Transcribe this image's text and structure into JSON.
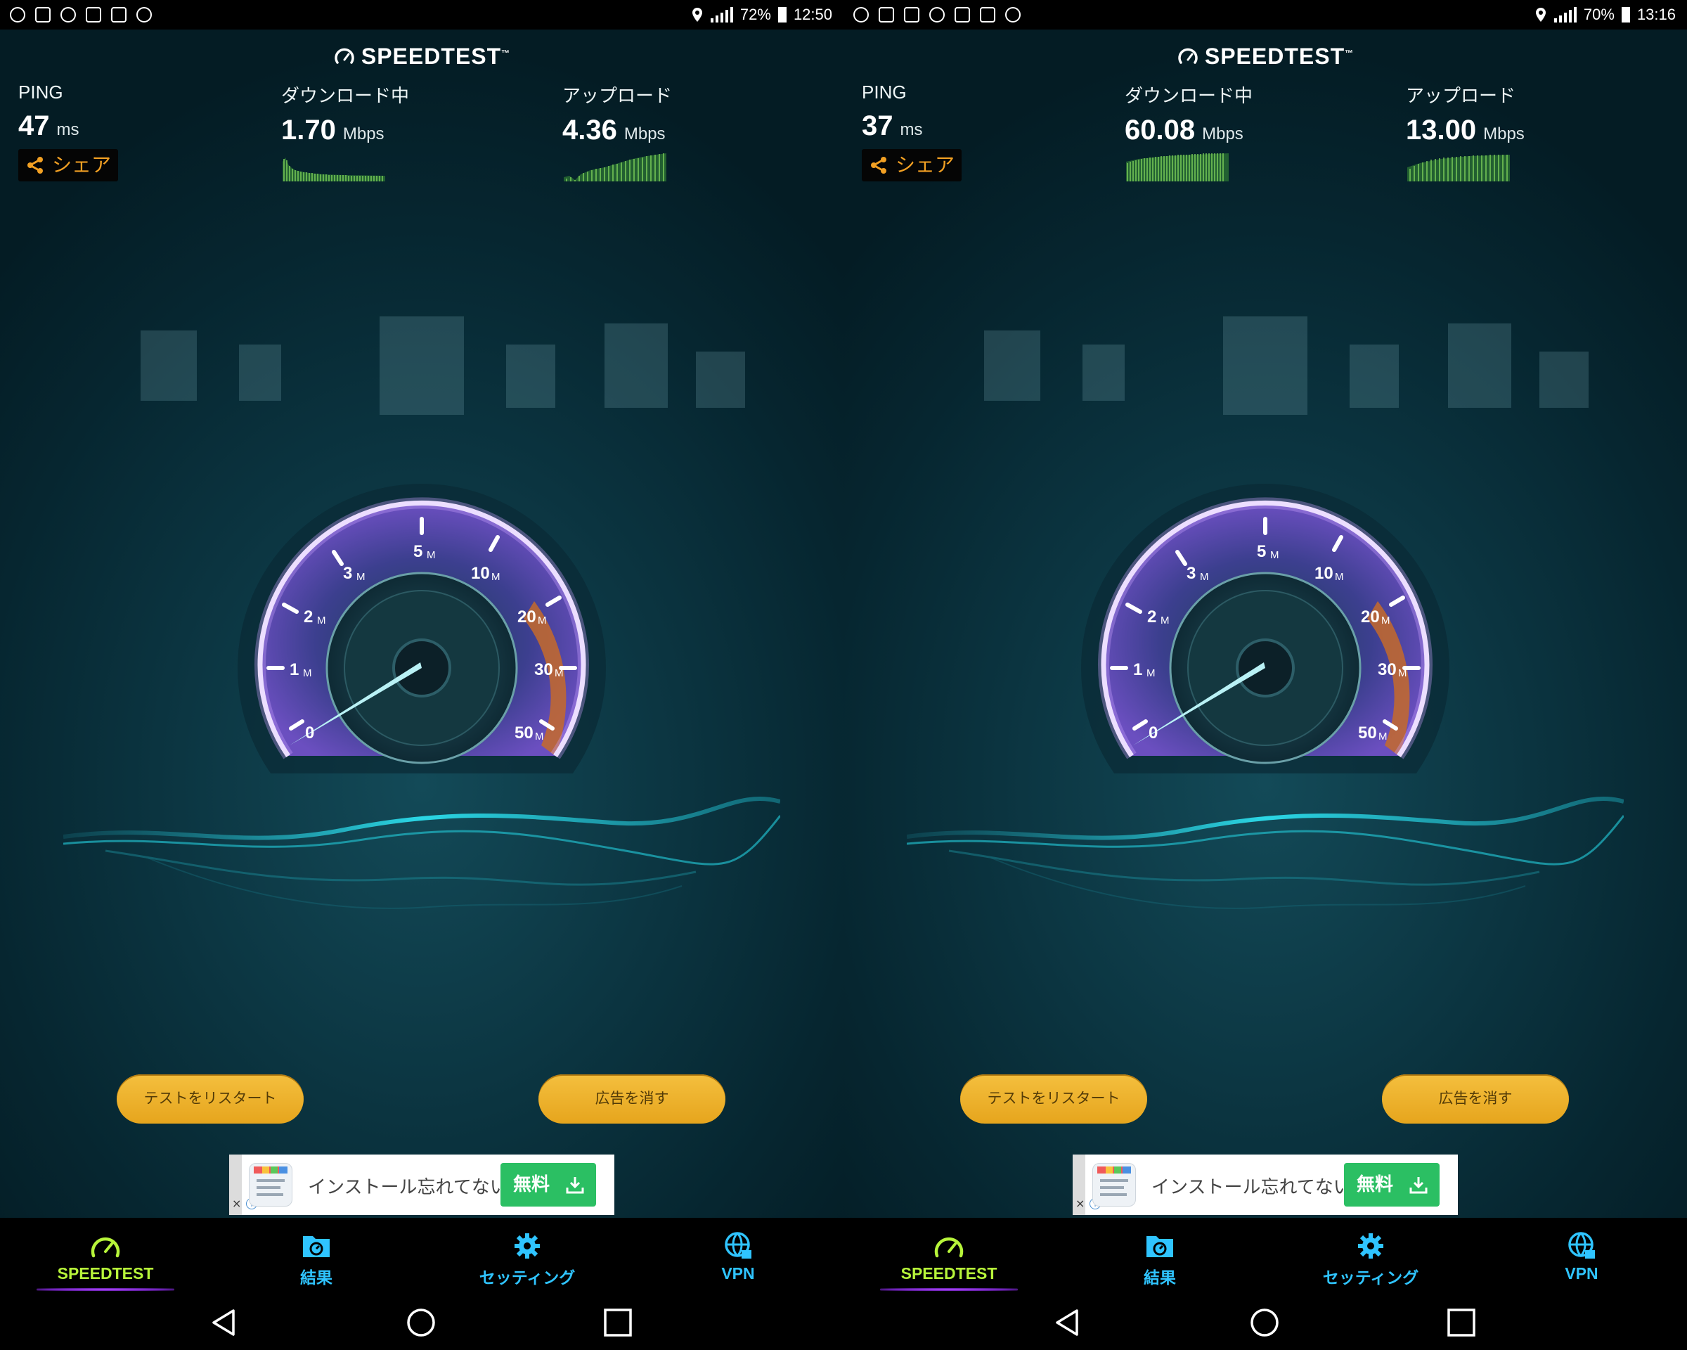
{
  "screens": [
    {
      "status": {
        "battery": "72%",
        "time": "12:50"
      },
      "logo": "SPEEDTEST",
      "ping": {
        "label": "PING",
        "value": "47",
        "unit": "ms"
      },
      "download": {
        "label": "ダウンロード中",
        "value": "1.70",
        "unit": "Mbps"
      },
      "upload": {
        "label": "アップロード",
        "value": "4.36",
        "unit": "Mbps"
      },
      "share_label": "シェア",
      "gauge_ticks": {
        "t0": "0",
        "t1": "1",
        "t2": "2",
        "t3": "3",
        "t5": "5",
        "t10": "10",
        "t20": "20",
        "t30": "30",
        "t50": "50",
        "unit": "M"
      },
      "buttons": {
        "restart": "テストをリスタート",
        "remove_ads": "広告を消す"
      },
      "ad": {
        "text": "インストール忘れてない?",
        "cta": "無料",
        "close": "×",
        "info": "i"
      },
      "tabs": {
        "speedtest": "SPEEDTEST",
        "results": "結果",
        "settings": "セッティング",
        "vpn": "VPN"
      }
    },
    {
      "status": {
        "battery": "70%",
        "time": "13:16"
      },
      "logo": "SPEEDTEST",
      "ping": {
        "label": "PING",
        "value": "37",
        "unit": "ms"
      },
      "download": {
        "label": "ダウンロード中",
        "value": "60.08",
        "unit": "Mbps"
      },
      "upload": {
        "label": "アップロード",
        "value": "13.00",
        "unit": "Mbps"
      },
      "share_label": "シェア",
      "gauge_ticks": {
        "t0": "0",
        "t1": "1",
        "t2": "2",
        "t3": "3",
        "t5": "5",
        "t10": "10",
        "t20": "20",
        "t30": "30",
        "t50": "50",
        "unit": "M"
      },
      "buttons": {
        "restart": "テストをリスタート",
        "remove_ads": "広告を消す"
      },
      "ad": {
        "text": "インストール忘れてない?",
        "cta": "無料",
        "close": "×",
        "info": "i"
      },
      "tabs": {
        "speedtest": "SPEEDTEST",
        "results": "結果",
        "settings": "セッティング",
        "vpn": "VPN"
      }
    }
  ],
  "colors": {
    "accent_orange": "#f2a023",
    "tab_active": "#b7f53a",
    "tab_inactive": "#2fc4ff",
    "button": "#eeb02f",
    "sparkline": "#6ac64a"
  }
}
